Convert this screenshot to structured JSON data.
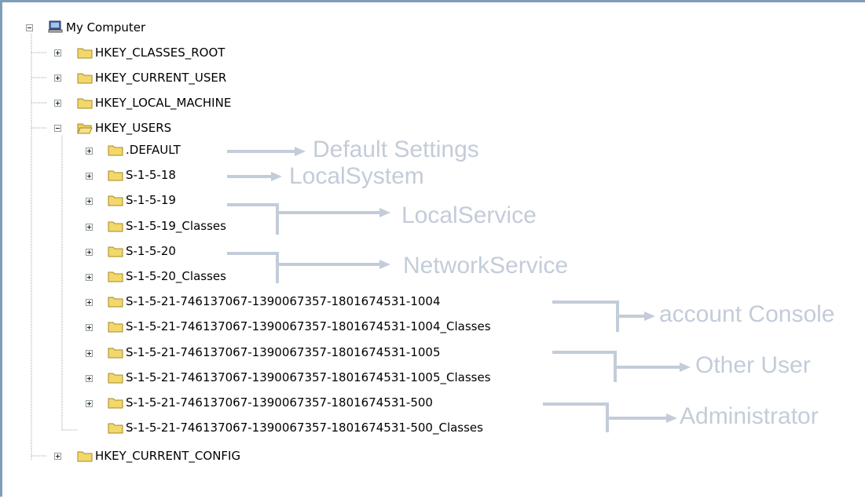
{
  "tree": {
    "root": "My Computer",
    "hives": {
      "classes_root": "HKEY_CLASSES_ROOT",
      "current_user": "HKEY_CURRENT_USER",
      "local_machine": "HKEY_LOCAL_MACHINE",
      "users": "HKEY_USERS",
      "current_config": "HKEY_CURRENT_CONFIG"
    },
    "users_children": [
      ".DEFAULT",
      "S-1-5-18",
      "S-1-5-19",
      "S-1-5-19_Classes",
      "S-1-5-20",
      "S-1-5-20_Classes",
      "S-1-5-21-746137067-1390067357-1801674531-1004",
      "S-1-5-21-746137067-1390067357-1801674531-1004_Classes",
      "S-1-5-21-746137067-1390067357-1801674531-1005",
      "S-1-5-21-746137067-1390067357-1801674531-1005_Classes",
      "S-1-5-21-746137067-1390067357-1801674531-500",
      "S-1-5-21-746137067-1390067357-1801674531-500_Classes"
    ]
  },
  "annotations": {
    "default": "Default Settings",
    "localsystem": "LocalSystem",
    "localservice": "LocalService",
    "networkservice": "NetworkService",
    "console": "account Console",
    "other": "Other User",
    "admin": "Administrator"
  },
  "colors": {
    "annotation": "#c3ccd9",
    "folder": "#f2d86b",
    "frame": "#7f9db9"
  },
  "icons": {
    "root": "computer-icon",
    "folder": "folder-icon",
    "open_folder": "folder-open-icon"
  }
}
